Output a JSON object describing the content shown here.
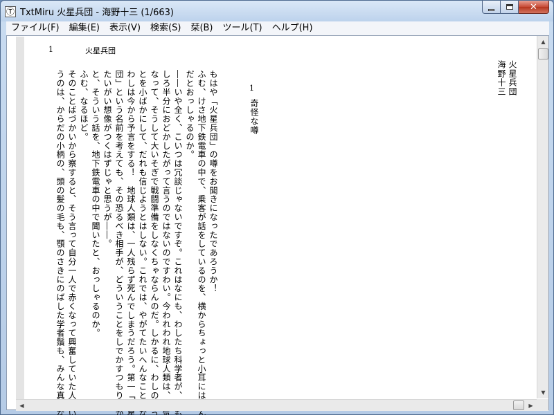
{
  "window": {
    "title": "TxtMiru 火星兵団 - 海野十三 (1/663)",
    "app_icon_glyph": "Ⓣ",
    "minimize_icon": "minimize-icon",
    "maximize_icon": "maximize-icon",
    "close_icon": "close-icon",
    "close_glyph": "✕"
  },
  "menu": {
    "items": [
      {
        "label": "ファイル(F)"
      },
      {
        "label": "編集(E)"
      },
      {
        "label": "表示(V)"
      },
      {
        "label": "検索(S)"
      },
      {
        "label": "栞(B)"
      },
      {
        "label": "ツール(T)"
      },
      {
        "label": "ヘルプ(H)"
      }
    ]
  },
  "page_header": {
    "number": "1",
    "title": "火星兵団"
  },
  "book": {
    "title": "火星兵団",
    "author": "海野十三",
    "chapter_number": "1",
    "chapter_title": "奇怪な噂"
  },
  "text_columns": [
    "もはや「火星兵団」の噂をお聞きになったであろうか！",
    "ふむ、けさ地下鉄電車の中で、乗客が話をしているのを、横からちょっと小耳にはさん",
    "だとおっしゃるのか。",
    "――いや全く、こいつは冗談じゃないですぞ。これはなにも、わしたち科学者が、おも",
    "しろ半分におどかしたがって言うのではないのですわい。今われわれ地球人類は、本気に",
    "なって、そうして大いそぎで戦闘準備をしなくちゃならんのだ。しかるに、わしのいうこ",
    "とを小ばかにして、だれも信じようとはしない。これでは、やがてたいへんなことになる。",
    "わしは今から予言をする！　地球人類は、一人残らず死んでしまうだろう。第一「火星兵",
    "団」という名前を考えても、その恐るべき相手が、どういうことをしでかすつもりだか、",
    "たいがい想像がつくはずじゃと思うが――。",
    "と、そういう話を、地下鉄電車の中で聞いたと、おっしゃるのか。",
    "ふむ、なるほど。",
    "そのことばづかいから察すると、そう言って自分一人で赤くなって興奮していた人とい",
    "うのは、からだの小柄の、頭の髪の毛も、顎のさきにのばした学者鬚も、みんな真白な老"
  ],
  "scrollbars": {
    "up_glyph": "▲",
    "down_glyph": "▼",
    "left_glyph": "◀",
    "right_glyph": "▶"
  }
}
